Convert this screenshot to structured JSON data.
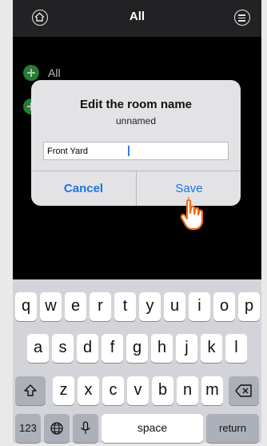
{
  "header": {
    "title": "All"
  },
  "list": {
    "items": [
      {
        "label": "All"
      }
    ]
  },
  "dialog": {
    "title": "Edit the room name",
    "subtitle": "unnamed",
    "input_value": "Front Yard",
    "cancel_label": "Cancel",
    "save_label": "Save"
  },
  "keyboard": {
    "row1": [
      "q",
      "w",
      "e",
      "r",
      "t",
      "y",
      "u",
      "i",
      "o",
      "p"
    ],
    "row2": [
      "a",
      "s",
      "d",
      "f",
      "g",
      "h",
      "j",
      "k",
      "l"
    ],
    "row3": [
      "z",
      "x",
      "c",
      "v",
      "b",
      "n",
      "m"
    ],
    "numbers_label": "123",
    "space_label": "space",
    "return_label": "return",
    "icons": [
      "shift-icon",
      "backspace-icon",
      "globe-icon",
      "microphone-icon"
    ]
  },
  "colors": {
    "accent": "#1a74e8",
    "add": "#2fa744",
    "keyboard_bg": "#d3d4d9"
  }
}
